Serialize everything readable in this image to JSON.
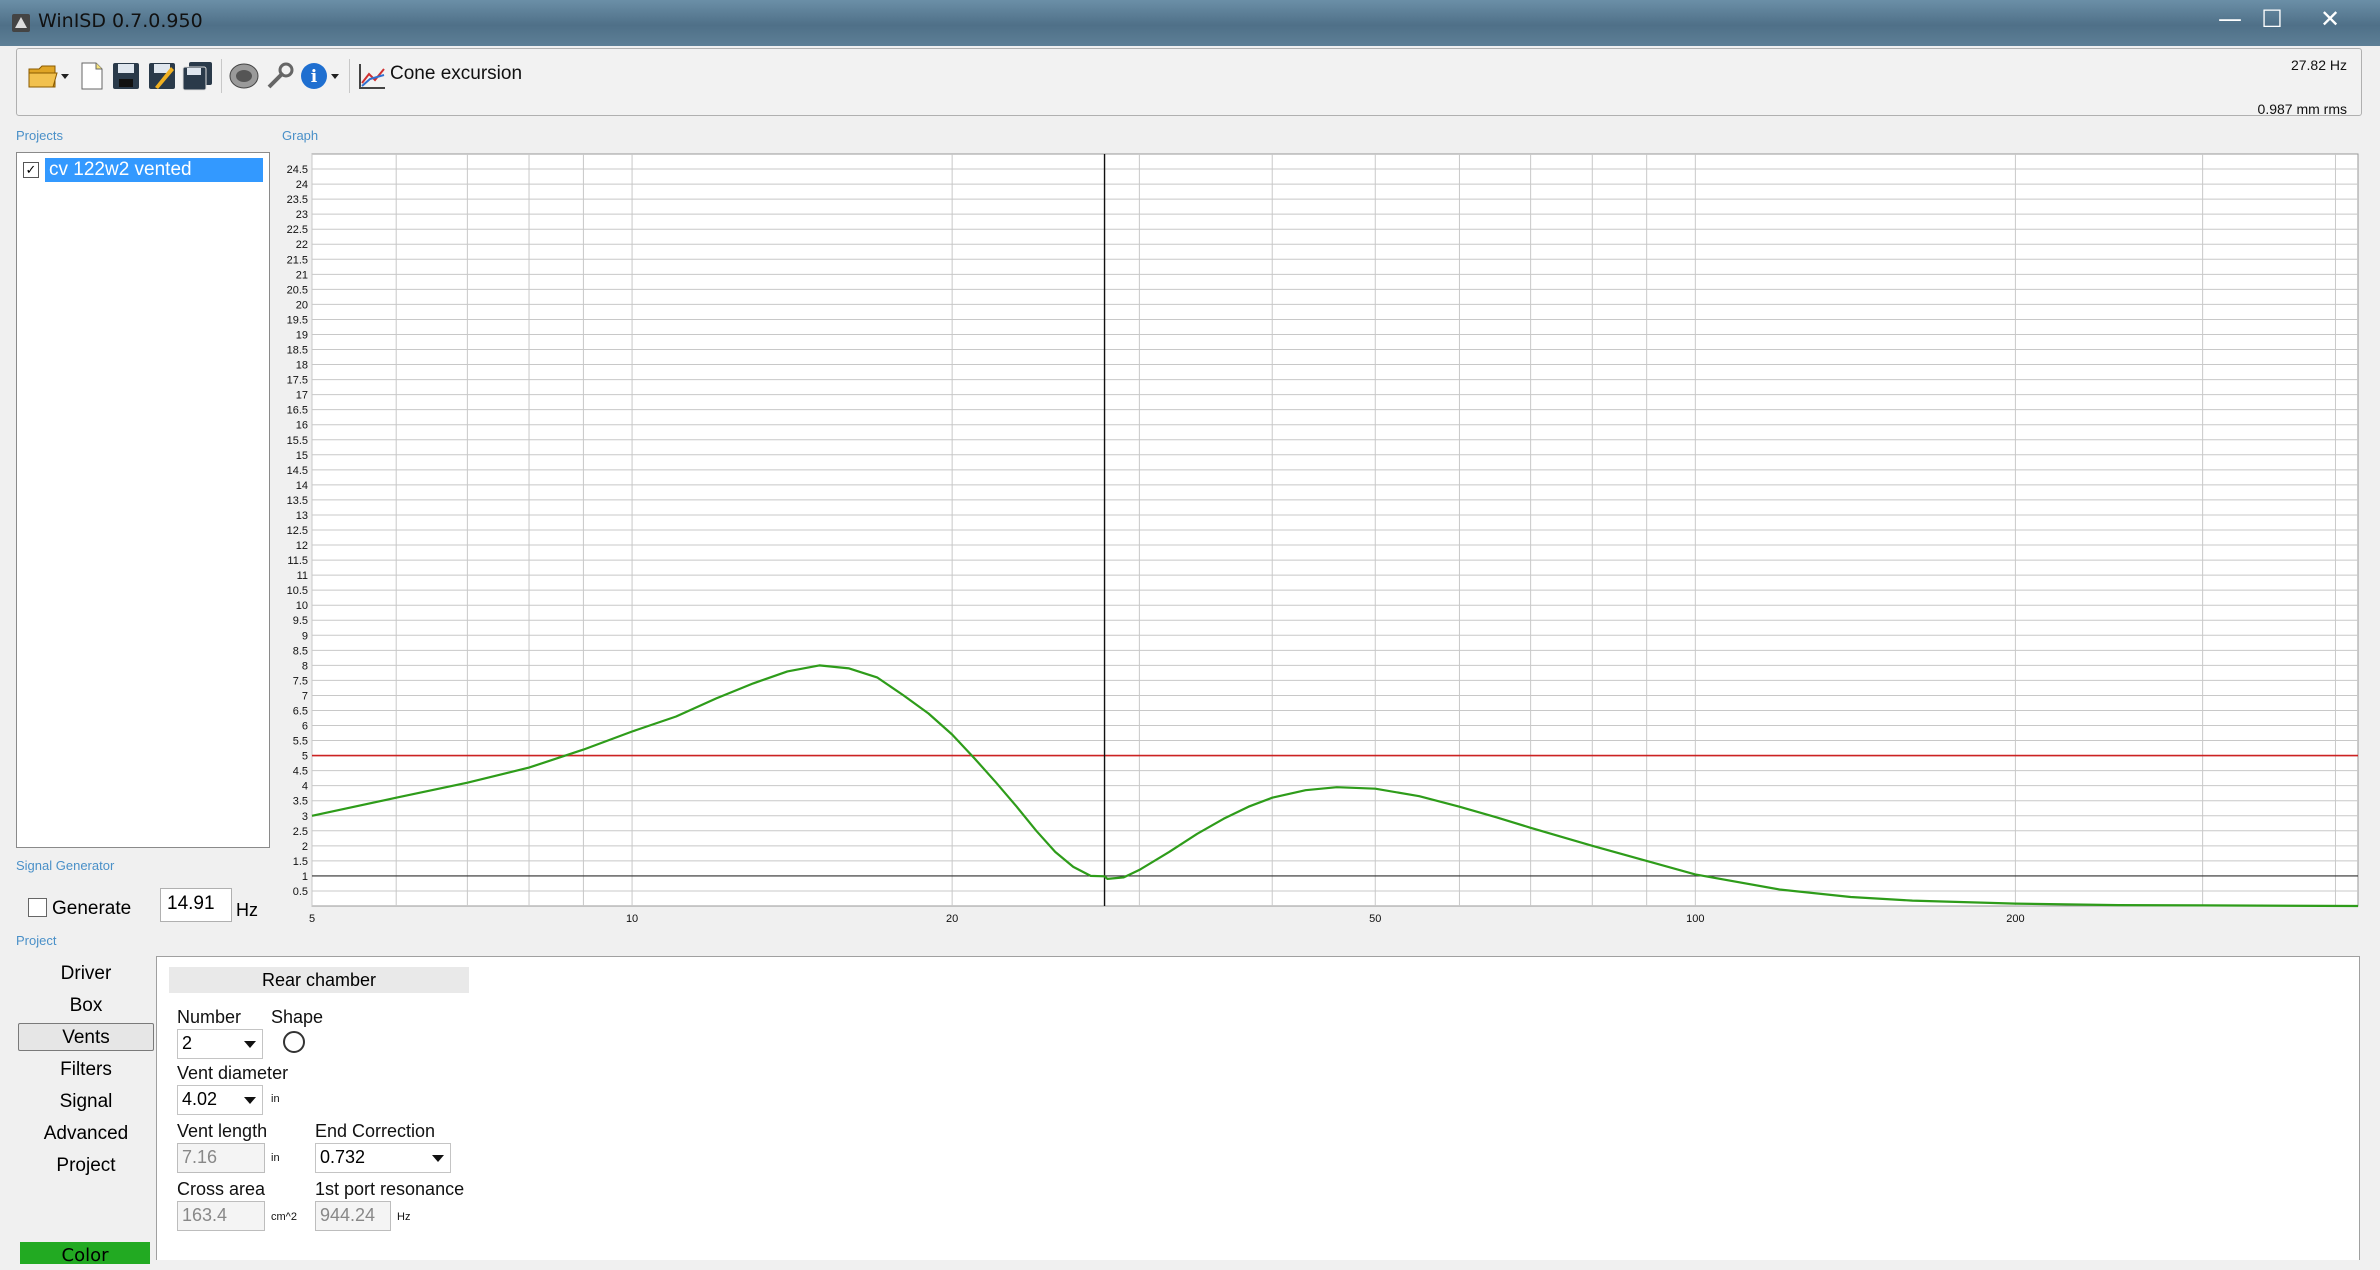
{
  "window": {
    "title": "WinISD 0.7.0.950"
  },
  "window_controls": {
    "minimize": "—",
    "maximize": "☐",
    "close": "✕"
  },
  "toolbar": {
    "icons": [
      "open-folder-icon",
      "new-file-icon",
      "save-icon",
      "save-as-icon",
      "save-all-icon",
      "speaker-driver-icon",
      "settings-wrench-icon",
      "info-icon",
      "graph-type-icon"
    ],
    "graph_label": "Cone excursion"
  },
  "readout": {
    "frequency": "27.82 Hz",
    "value": "0.987 mm rms"
  },
  "projects": {
    "section_label": "Projects",
    "items": [
      {
        "name": "cv 122w2 vented",
        "checked": true
      }
    ]
  },
  "graph": {
    "section_label": "Graph"
  },
  "signal_generator": {
    "section_label": "Signal Generator",
    "generate_label": "Generate",
    "frequency_value": "14.91",
    "unit": "Hz"
  },
  "project_nav": {
    "section_label": "Project",
    "items": [
      "Driver",
      "Box",
      "Vents",
      "Filters",
      "Signal",
      "Advanced",
      "Project"
    ],
    "active": "Vents",
    "color_button": "Color"
  },
  "vents_panel": {
    "header": "Rear chamber",
    "number_label": "Number",
    "number_value": "2",
    "shape_label": "Shape",
    "vent_diameter_label": "Vent diameter",
    "vent_diameter_value": "4.02",
    "vent_diameter_unit": "in",
    "vent_length_label": "Vent length",
    "vent_length_value": "7.16",
    "vent_length_unit": "in",
    "end_correction_label": "End Correction",
    "end_correction_value": "0.732",
    "cross_area_label": "Cross area",
    "cross_area_value": "163.4",
    "cross_area_unit": "cm^2",
    "port_resonance_label": "1st port resonance",
    "port_resonance_value": "944.24",
    "port_resonance_unit": "Hz"
  },
  "chart_data": {
    "type": "line",
    "x_scale": "log",
    "xlim": [
      5,
      420
    ],
    "ylim": [
      0,
      25
    ],
    "x_tick_labels": [
      5,
      10,
      20,
      50,
      100,
      200
    ],
    "y_tick_labels": [
      0.5,
      1,
      1.5,
      2,
      2.5,
      3,
      3.5,
      4,
      4.5,
      5,
      5.5,
      6,
      6.5,
      7,
      7.5,
      8,
      8.5,
      9,
      9.5,
      10,
      10.5,
      11,
      11.5,
      12,
      12.5,
      13,
      13.5,
      14,
      14.5,
      15,
      15.5,
      16,
      16.5,
      17,
      17.5,
      18,
      18.5,
      19,
      19.5,
      20,
      20.5,
      21,
      21.5,
      22,
      22.5,
      23,
      23.5,
      24,
      24.5
    ],
    "grid": true,
    "cursor_x": 27.82,
    "limit_line": 5.0,
    "reference_line": 1.0,
    "colors": {
      "series": "#2e9c1a",
      "limit": "#cc2222",
      "reference": "#333333",
      "cursor": "#111111",
      "grid": "#c8c8c8"
    },
    "series": [
      {
        "x": [
          5,
          6,
          7,
          8,
          9,
          10,
          11,
          12,
          13,
          14,
          15,
          16,
          17,
          18,
          19,
          20,
          21,
          22,
          23,
          24,
          25,
          26,
          27,
          27.82,
          28,
          29,
          30,
          32,
          34,
          36,
          38,
          40,
          43,
          46,
          50,
          55,
          60,
          65,
          70,
          80,
          90,
          100,
          120,
          140,
          160,
          200,
          250,
          300,
          420
        ],
        "y": [
          3.0,
          3.6,
          4.1,
          4.6,
          5.2,
          5.8,
          6.3,
          6.9,
          7.4,
          7.8,
          8.0,
          7.9,
          7.6,
          7.0,
          6.4,
          5.7,
          4.9,
          4.1,
          3.3,
          2.5,
          1.8,
          1.3,
          1.0,
          0.987,
          0.9,
          0.95,
          1.2,
          1.8,
          2.4,
          2.9,
          3.3,
          3.6,
          3.85,
          3.95,
          3.9,
          3.65,
          3.3,
          2.95,
          2.6,
          2.0,
          1.5,
          1.05,
          0.55,
          0.3,
          0.18,
          0.08,
          0.03,
          0.02,
          0.0
        ]
      }
    ]
  }
}
